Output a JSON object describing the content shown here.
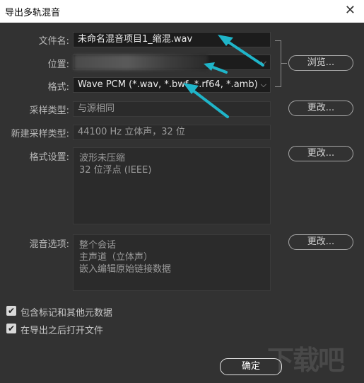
{
  "window": {
    "title": "导出多轨混音",
    "close_glyph": "✕"
  },
  "form": {
    "filename_label": "文件名:",
    "filename_value": "未命名混音项目1_缩混.wav",
    "location_label": "位置:",
    "location_value": "",
    "format_label": "格式:",
    "format_value": "Wave PCM (*.wav, *.bwf, *.rf64, *.amb)",
    "sample_type_label": "采样类型:",
    "sample_type_value": "与源相同",
    "new_sample_type_label": "新建采样类型:",
    "new_sample_type_value": "44100 Hz 立体声，32 位",
    "format_settings_label": "格式设置:",
    "format_settings_lines": [
      "波形未压缩",
      "32 位浮点 (IEEE)"
    ],
    "mix_options_label": "混音选项:",
    "mix_options_lines": [
      "整个会话",
      "主声道（立体声）",
      "嵌入编辑原始链接数据"
    ]
  },
  "buttons": {
    "browse": "浏览...",
    "change_sample": "更改...",
    "change_format": "更改...",
    "change_mix": "更改...",
    "ok": "确定"
  },
  "checkboxes": [
    {
      "label": "包含标记和其他元数据",
      "checked": true
    },
    {
      "label": "在导出之后打开文件",
      "checked": true
    }
  ],
  "icons": {
    "dropdown": "chevron-down-icon",
    "check": "checkmark-icon",
    "close": "close-icon"
  },
  "colors": {
    "annotation_arrow": "#1fb5c9",
    "dialog_bg": "#323232",
    "titlebar_bg": "#ffffff"
  },
  "watermark": "下载吧"
}
